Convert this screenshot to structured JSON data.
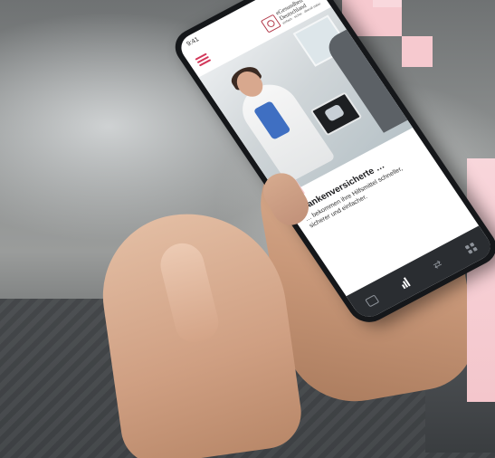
{
  "phone": {
    "time": "9:41",
    "status_icons": "▂▄▆ ◠ ▭",
    "brand": {
      "line1": "eGesundheit",
      "line2": "Deutschland",
      "slogan": "einfach · sicher · überall dabei"
    },
    "card": {
      "title": "Krankenversicherte …",
      "text": "… bekommen ihre Hilfsmittel schneller, sicherer und einfacher."
    },
    "tabs": [
      {
        "icon": "card-icon"
      },
      {
        "icon": "bar-chart-icon",
        "active": true
      },
      {
        "icon": "swap-icon"
      },
      {
        "icon": "grid-icon"
      }
    ]
  },
  "colors": {
    "accent_pink": "#f6c9cf",
    "menu_pink": "#d2385a",
    "tabbar": "#2a2d31"
  }
}
